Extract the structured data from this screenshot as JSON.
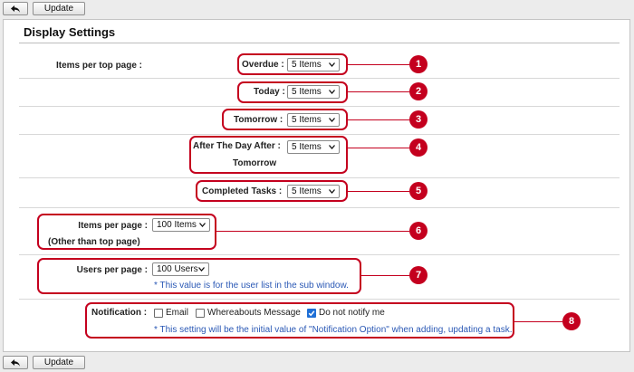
{
  "toolbar": {
    "update_label": "Update"
  },
  "panel": {
    "title": "Display Settings"
  },
  "top_page": {
    "label": "Items per top page :",
    "rows": [
      {
        "label": "Overdue :",
        "value": "5 Items",
        "marker": "1"
      },
      {
        "label": "Today :",
        "value": "5 Items",
        "marker": "2"
      },
      {
        "label": "Tomorrow :",
        "value": "5 Items",
        "marker": "3"
      },
      {
        "label": "After The Day After :",
        "label2": "Tomorrow",
        "value": "5 Items",
        "marker": "4"
      },
      {
        "label": "Completed Tasks :",
        "value": "5 Items",
        "marker": "5"
      }
    ]
  },
  "items_per_page": {
    "label": "Items per page :",
    "label2": "(Other than top page)",
    "value": "100 Items",
    "marker": "6"
  },
  "users_per_page": {
    "label": "Users per page :",
    "value": "100 Users",
    "note": "* This value is for the user list in the sub window.",
    "marker": "7"
  },
  "notification": {
    "label": "Notification :",
    "options": [
      {
        "label": "Email",
        "checked": false
      },
      {
        "label": "Whereabouts Message",
        "checked": false
      },
      {
        "label": "Do not notify me",
        "checked": true
      }
    ],
    "note": "* This setting will be the initial value of \"Notification Option\" when adding, updating a task.",
    "marker": "8"
  },
  "colors": {
    "annotation": "#c4001e",
    "note_text": "#2a58b5",
    "checkbox_checked": "#1e6fd6"
  },
  "icons": {
    "back": "back-arrow-icon",
    "dropdown": "chevron-down-icon",
    "check": "checkmark-icon"
  }
}
